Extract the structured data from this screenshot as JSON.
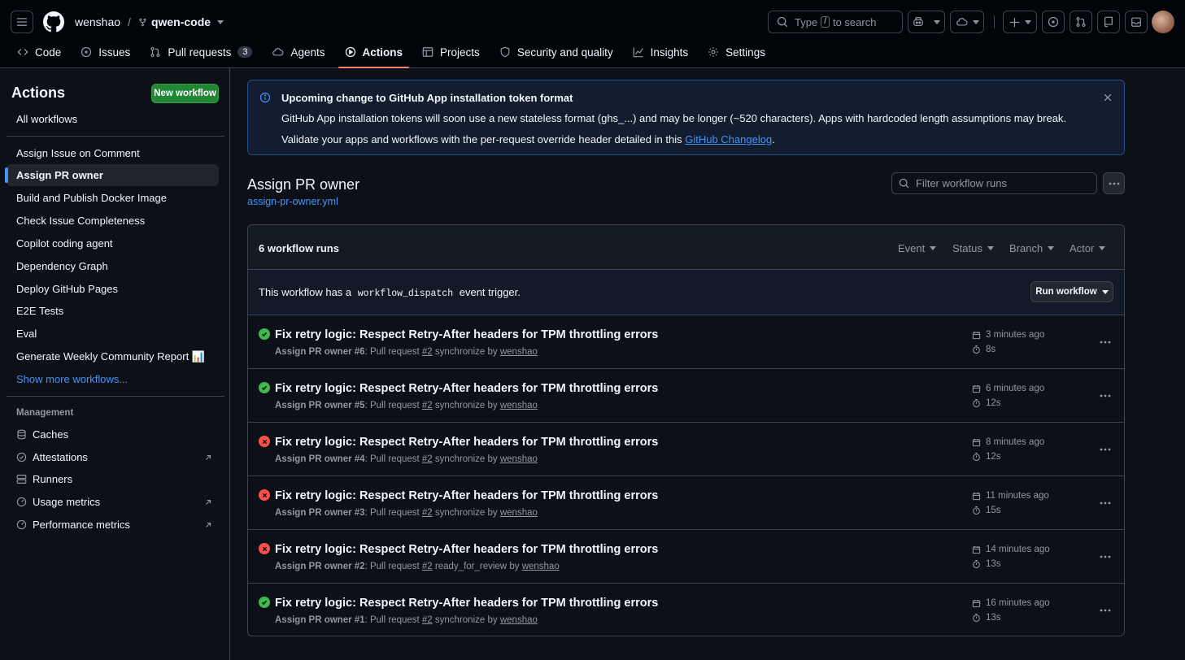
{
  "header": {
    "owner": "wenshao",
    "separator": "/",
    "repo": "qwen-code",
    "search_prefix": "Type",
    "search_key": "/",
    "search_suffix": "to search"
  },
  "tabs": [
    {
      "label": "Code"
    },
    {
      "label": "Issues"
    },
    {
      "label": "Pull requests",
      "count": "3"
    },
    {
      "label": "Agents"
    },
    {
      "label": "Actions"
    },
    {
      "label": "Projects"
    },
    {
      "label": "Security and quality"
    },
    {
      "label": "Insights"
    },
    {
      "label": "Settings"
    }
  ],
  "sidebar": {
    "title": "Actions",
    "new_workflow": "New workflow",
    "all_workflows": "All workflows",
    "workflows": [
      "Assign Issue on Comment",
      "Assign PR owner",
      "Build and Publish Docker Image",
      "Check Issue Completeness",
      "Copilot coding agent",
      "Dependency Graph",
      "Deploy GitHub Pages",
      "E2E Tests",
      "Eval",
      "Generate Weekly Community Report 📊"
    ],
    "show_more": "Show more workflows...",
    "management_heading": "Management",
    "management": [
      "Caches",
      "Attestations",
      "Runners",
      "Usage metrics",
      "Performance metrics"
    ]
  },
  "banner": {
    "title": "Upcoming change to GitHub App installation token format",
    "line1": "GitHub App installation tokens will soon use a new stateless format (ghs_...) and may be longer (~520 characters). Apps with hardcoded length assumptions may break.",
    "line2_prefix": "Validate your apps and workflows with the per-request override header detailed in this",
    "line2_link": "GitHub Changelog",
    "line2_suffix": "."
  },
  "workflow": {
    "title": "Assign PR owner",
    "file": "assign-pr-owner.yml",
    "filter_placeholder": "Filter workflow runs",
    "run_count": "6 workflow runs",
    "filters": [
      "Event",
      "Status",
      "Branch",
      "Actor"
    ],
    "dispatch_prefix": "This workflow has a",
    "dispatch_code": "workflow_dispatch",
    "dispatch_suffix": "event trigger.",
    "run_button": "Run workflow"
  },
  "runs": [
    {
      "status": "success",
      "title": "Fix retry logic: Respect Retry-After headers for TPM throttling errors",
      "workflow": "Assign PR owner",
      "num": "#6",
      "pr_text": ": Pull request",
      "pr": "#2",
      "event": "synchronize",
      "by": "by",
      "actor": "wenshao",
      "when": "3 minutes ago",
      "duration": "8s"
    },
    {
      "status": "success",
      "title": "Fix retry logic: Respect Retry-After headers for TPM throttling errors",
      "workflow": "Assign PR owner",
      "num": "#5",
      "pr_text": ": Pull request",
      "pr": "#2",
      "event": "synchronize",
      "by": "by",
      "actor": "wenshao",
      "when": "6 minutes ago",
      "duration": "12s"
    },
    {
      "status": "failure",
      "title": "Fix retry logic: Respect Retry-After headers for TPM throttling errors",
      "workflow": "Assign PR owner",
      "num": "#4",
      "pr_text": ": Pull request",
      "pr": "#2",
      "event": "synchronize",
      "by": "by",
      "actor": "wenshao",
      "when": "8 minutes ago",
      "duration": "12s"
    },
    {
      "status": "failure",
      "title": "Fix retry logic: Respect Retry-After headers for TPM throttling errors",
      "workflow": "Assign PR owner",
      "num": "#3",
      "pr_text": ": Pull request",
      "pr": "#2",
      "event": "synchronize",
      "by": "by",
      "actor": "wenshao",
      "when": "11 minutes ago",
      "duration": "15s"
    },
    {
      "status": "failure",
      "title": "Fix retry logic: Respect Retry-After headers for TPM throttling errors",
      "workflow": "Assign PR owner",
      "num": "#2",
      "pr_text": ": Pull request",
      "pr": "#2",
      "event": "ready_for_review",
      "by": "by",
      "actor": "wenshao",
      "when": "14 minutes ago",
      "duration": "13s"
    },
    {
      "status": "success",
      "title": "Fix retry logic: Respect Retry-After headers for TPM throttling errors",
      "workflow": "Assign PR owner",
      "num": "#1",
      "pr_text": ": Pull request",
      "pr": "#2",
      "event": "synchronize",
      "by": "by",
      "actor": "wenshao",
      "when": "16 minutes ago",
      "duration": "13s"
    }
  ],
  "colors": {
    "success": "#3fb950",
    "failure": "#f85149",
    "accent": "#4493f8",
    "active_tab_underline": "#f78166",
    "primary_button": "#238636"
  }
}
